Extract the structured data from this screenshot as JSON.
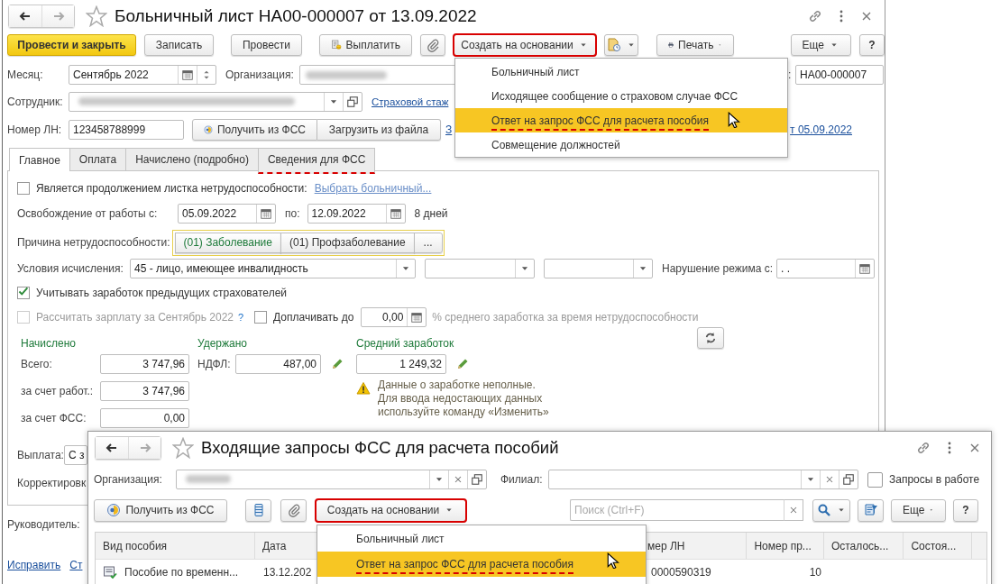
{
  "main_window": {
    "title": "Больничный лист НА00-000007 от 13.09.2022",
    "toolbar": [
      {
        "kind": "primary",
        "label": "Провести и закрыть",
        "marked": false
      },
      {
        "kind": "plain",
        "label": "Записать",
        "marked": false
      },
      {
        "kind": "plain",
        "label": "Провести",
        "marked": false
      },
      {
        "kind": "pay",
        "label": "Выплатить",
        "marked": false
      },
      {
        "kind": "attach",
        "marked": false
      },
      {
        "kind": "dropdown",
        "label": "Создать на основании",
        "marked": true
      },
      {
        "kind": "template",
        "marked": false
      },
      {
        "kind": "print",
        "label": "Печать",
        "marked": false
      }
    ],
    "more_button": "Еще",
    "help_button": "?",
    "month": {
      "label": "Месяц:",
      "value": "Сентябрь 2022"
    },
    "organization": {
      "label": "Организация:"
    },
    "number": {
      "label": ":",
      "value": "НА00-000007"
    },
    "employee": {
      "label": "Сотрудник:"
    },
    "insurance_link": "Страховой стаж",
    "sick_number": {
      "label": "Номер ЛН:",
      "value": "123458788999"
    },
    "fss_buttons": [
      "Получить из ФСС",
      "Загрузить из файла"
    ],
    "link_fragment_left": "З",
    "link_fragment_right": "т 05.09.2022",
    "tabs": [
      {
        "label": "Главное",
        "selected": true,
        "marked": false
      },
      {
        "label": "Оплата",
        "selected": false,
        "marked": false
      },
      {
        "label": "Начислено (подробно)",
        "selected": false,
        "marked": false
      },
      {
        "label": "Сведения для ФСС",
        "selected": false,
        "marked": true
      }
    ],
    "continuation": {
      "checked": false,
      "label": "Является продолжением листка нетрудоспособности:",
      "link": "Выбрать больничный..."
    },
    "release": {
      "label": "Освобождение от работы с:",
      "from": "05.09.2022",
      "to_label": "по:",
      "to": "12.09.2022",
      "days": "8 дней"
    },
    "reason": {
      "label": "Причина нетрудоспособности:",
      "options": [
        {
          "label": "(01) Заболевание",
          "selected": true
        },
        {
          "label": "(01) Профзаболевание",
          "selected": false
        }
      ],
      "more": "..."
    },
    "conditions": {
      "label": "Условия исчисления:",
      "value": "45 - лицо, имеющее инвалидность",
      "violation_label": "Нарушение режима с:",
      "violation_value": ". ."
    },
    "prev_insurers": {
      "checked": true,
      "label": "Учитывать заработок предыдущих страхователей"
    },
    "calc_salary": {
      "checked": false,
      "disabled": true,
      "label": "Рассчитать зарплату за Сентябрь 2022",
      "help": "?"
    },
    "extra_pay": {
      "checked": false,
      "label": "Доплачивать до",
      "value": "0,00",
      "suffix": "% среднего заработка за время нетрудоспособности"
    },
    "accrued": {
      "heading": "Начислено",
      "rows": [
        {
          "label": "Всего:",
          "value": "3 747,96"
        },
        {
          "label": "за счет работ.:",
          "value": "3 747,96"
        },
        {
          "label": "за счет ФСС:",
          "value": "0,00"
        }
      ]
    },
    "withheld": {
      "heading": "Удержано",
      "label": "НДФЛ:",
      "value": "487,00"
    },
    "average": {
      "heading": "Средний заработок",
      "value": "1 249,32",
      "warning": "Данные о заработке неполные.\nДля ввода недостающих данных\nиспользуйте команду «Изменить»"
    },
    "payment": {
      "label": "Выплата:",
      "value": "С з"
    },
    "correction_label": "Корректировк",
    "manager_label": "Руководитель:",
    "footer_links": [
      "Исправить",
      "Ст"
    ]
  },
  "create_menu": [
    {
      "label": "Больничный лист",
      "selected": false,
      "marked": false
    },
    {
      "label": "Исходящее сообщение о страховом случае ФСС",
      "selected": false,
      "marked": false
    },
    {
      "label": "Ответ на запрос ФСС для расчета пособия",
      "selected": true,
      "marked": true
    },
    {
      "label": "Совмещение должностей",
      "selected": false,
      "marked": false
    }
  ],
  "requests_window": {
    "title": "Входящие запросы ФСС для расчета пособий",
    "organization_label": "Организация:",
    "branch_label": "Филиал:",
    "in_work": {
      "checked": false,
      "label": "Запросы в работе"
    },
    "get_button": "Получить из ФСС",
    "create_button": {
      "label": "Создать на основании",
      "marked": true
    },
    "search": {
      "placeholder": "Поиск (Ctrl+F)"
    },
    "more_button": "Еще",
    "help_button": "?",
    "columns": [
      "Вид пособия",
      "Дата",
      "мер ЛН",
      "Номер пр...",
      "Осталось...",
      "Состоя..."
    ],
    "rows": [
      {
        "type": "Пособие по временн...",
        "date": "13.12.202",
        "number": "0000590319",
        "extension": "10"
      }
    ],
    "menu": [
      {
        "label": "Больничный лист",
        "selected": false,
        "marked": false
      },
      {
        "label": "Ответ на запрос ФСС для расчета пособия",
        "selected": true,
        "marked": true
      }
    ]
  }
}
